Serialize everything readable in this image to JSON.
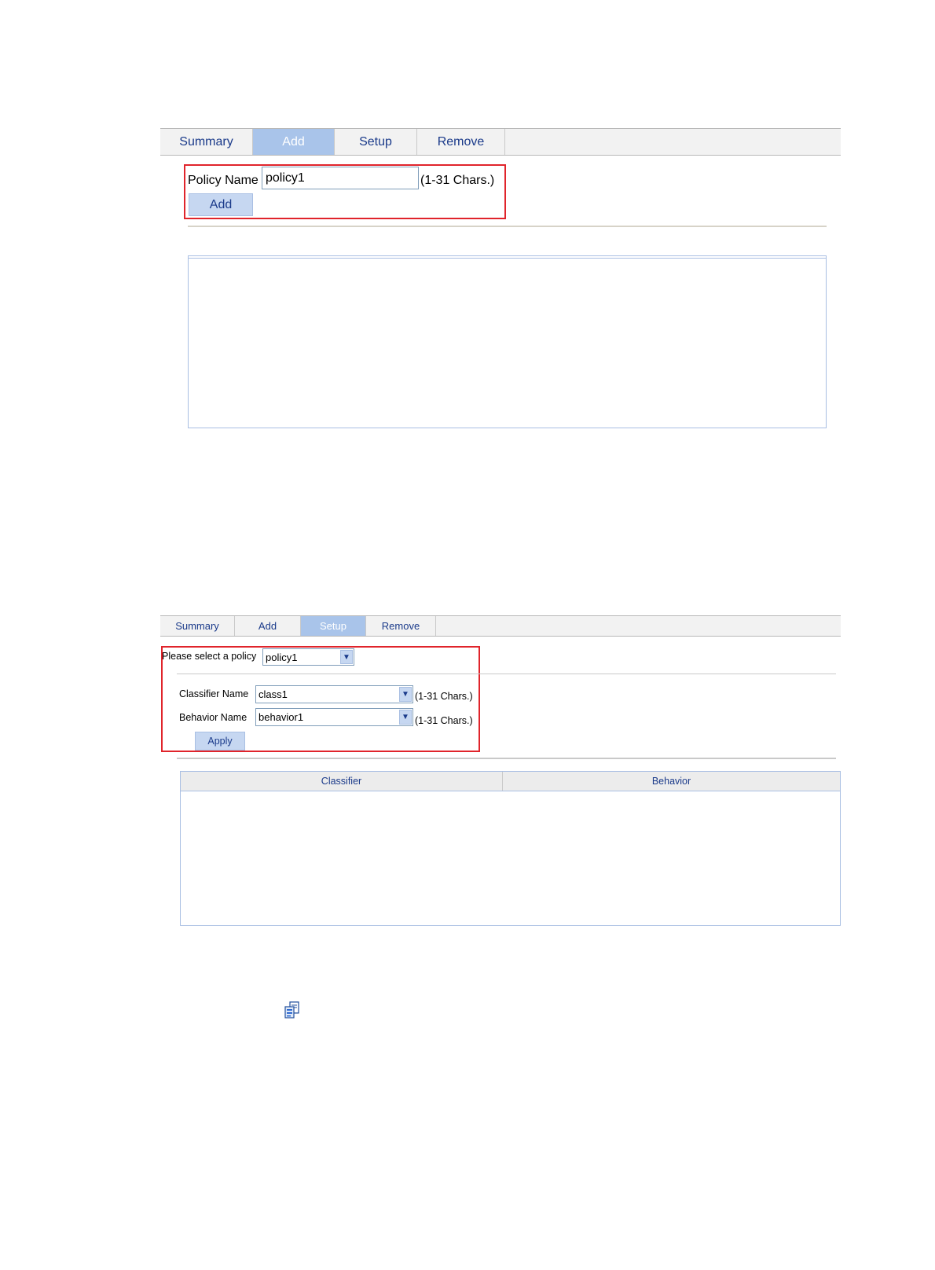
{
  "add_policy_screen": {
    "tabs": [
      {
        "label": "Summary",
        "active": false
      },
      {
        "label": "Add",
        "active": true
      },
      {
        "label": "Setup",
        "active": false
      },
      {
        "label": "Remove",
        "active": false
      }
    ],
    "policy_name_label": "Policy Name",
    "policy_name_value": "policy1",
    "policy_name_hint": "(1-31 Chars.)",
    "add_button_label": "Add"
  },
  "setup_policy_screen": {
    "tabs": [
      {
        "label": "Summary",
        "active": false
      },
      {
        "label": "Add",
        "active": false
      },
      {
        "label": "Setup",
        "active": true
      },
      {
        "label": "Remove",
        "active": false
      }
    ],
    "select_policy_label": "Please select a policy",
    "selected_policy": "policy1",
    "classifier_name_label": "Classifier Name",
    "classifier_name_value": "class1",
    "classifier_name_hint": "(1-31 Chars.)",
    "behavior_name_label": "Behavior Name",
    "behavior_name_value": "behavior1",
    "behavior_name_hint": "(1-31 Chars.)",
    "apply_button_label": "Apply",
    "table": {
      "columns": [
        "Classifier",
        "Behavior"
      ],
      "rows": []
    }
  },
  "icons": {
    "policy_icon": "copy-document-icon"
  },
  "colors": {
    "highlight_border": "#e0242b",
    "active_tab": "#a9c4ea",
    "button_bg": "#c6d7f1",
    "tab_text": "#1a3a8a"
  }
}
